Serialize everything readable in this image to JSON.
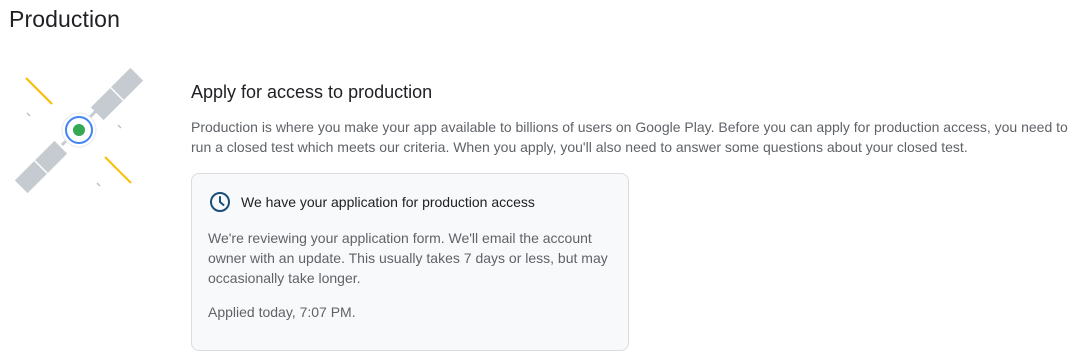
{
  "page": {
    "title": "Production"
  },
  "section": {
    "title": "Apply for access to production",
    "description": "Production is where you make your app available to billions of users on Google Play. Before you can apply for production access, you need to run a closed test which meets our criteria. When you apply, you'll also need to answer some questions about your closed test."
  },
  "status_card": {
    "icon": "clock-icon",
    "title": "We have your application for production access",
    "body": "We're reviewing your application form. We'll email the account owner with an update. This usually takes 7 days or less, but may occasionally take longer.",
    "applied": "Applied today, 7:07 PM."
  },
  "illustration": {
    "icon": "satellite-icon"
  },
  "colors": {
    "accent_blue": "#4285f4",
    "accent_green": "#34a853",
    "accent_yellow": "#fbbc04",
    "icon_dark_blue": "#1a4e7a",
    "panel_grey": "#c5cbd0"
  }
}
